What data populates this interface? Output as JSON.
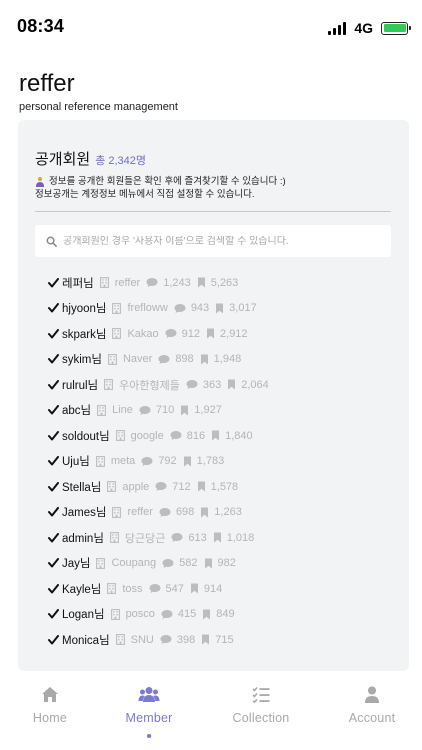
{
  "status_bar": {
    "time": "08:34",
    "network": "4G",
    "battery_color": "#34c759"
  },
  "app": {
    "title": "reffer",
    "subtitle": "personal reference management"
  },
  "section": {
    "title": "공개회원",
    "total": "총 2,342명",
    "notice_line1": "정보를 공개한 회원들은 확인 후에 즐겨찾기할 수 있습니다 :)",
    "notice_line2": "정보공개는 계정정보 메뉴에서 직접 설정할 수 있습니다."
  },
  "search": {
    "placeholder": "공개회원인 경우 '사용자 이름'으로 검색할 수 있습니다."
  },
  "members": [
    {
      "name": "레퍼님",
      "company": "reffer",
      "comments": "1,243",
      "bookmarks": "5,263"
    },
    {
      "name": "hjyoon님",
      "company": "frefloww",
      "comments": "943",
      "bookmarks": "3,017"
    },
    {
      "name": "skpark님",
      "company": "Kakao",
      "comments": "912",
      "bookmarks": "2,912"
    },
    {
      "name": "sykim님",
      "company": "Naver",
      "comments": "898",
      "bookmarks": "1,948"
    },
    {
      "name": "rulrul님",
      "company": "우아한형제들",
      "comments": "363",
      "bookmarks": "2,064"
    },
    {
      "name": "abc님",
      "company": "Line",
      "comments": "710",
      "bookmarks": "1,927"
    },
    {
      "name": "soldout님",
      "company": "google",
      "comments": "816",
      "bookmarks": "1,840"
    },
    {
      "name": "Uju님",
      "company": "meta",
      "comments": "792",
      "bookmarks": "1,783"
    },
    {
      "name": "Stella님",
      "company": "apple",
      "comments": "712",
      "bookmarks": "1,578"
    },
    {
      "name": "James님",
      "company": "reffer",
      "comments": "698",
      "bookmarks": "1,263"
    },
    {
      "name": "admin님",
      "company": "당근당근",
      "comments": "613",
      "bookmarks": "1,018"
    },
    {
      "name": "Jay님",
      "company": "Coupang",
      "comments": "582",
      "bookmarks": "982"
    },
    {
      "name": "Kayle님",
      "company": "toss",
      "comments": "547",
      "bookmarks": "914"
    },
    {
      "name": "Logan님",
      "company": "posco",
      "comments": "415",
      "bookmarks": "849"
    },
    {
      "name": "Monica님",
      "company": "SNU",
      "comments": "398",
      "bookmarks": "715"
    }
  ],
  "tabs": [
    {
      "label": "Home",
      "icon": "home-icon",
      "active": false
    },
    {
      "label": "Member",
      "icon": "users-icon",
      "active": true
    },
    {
      "label": "Collection",
      "icon": "checklist-icon",
      "active": false
    },
    {
      "label": "Account",
      "icon": "user-icon",
      "active": false
    }
  ],
  "colors": {
    "accent": "#7b7bd0",
    "card_background": "#f2f3f4",
    "muted_text": "#b5b5b5"
  }
}
